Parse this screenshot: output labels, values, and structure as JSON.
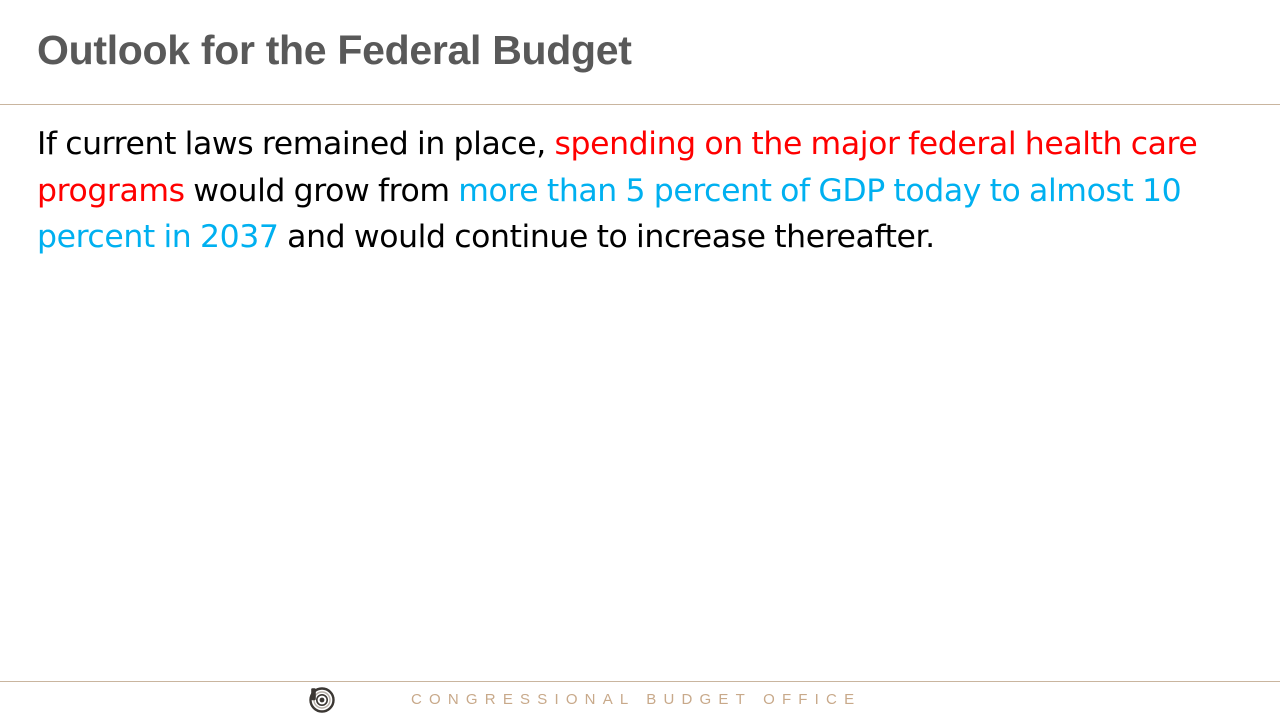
{
  "slide": {
    "title": "Outlook for the Federal Budget",
    "body": {
      "segments": [
        {
          "text": "If current laws remained in place, ",
          "color": "#000000"
        },
        {
          "text": "spending on the major federal health care programs",
          "color": "#ff0000"
        },
        {
          "text": " would grow from ",
          "color": "#000000"
        },
        {
          "text": "more than 5 percent of GDP today to almost 10 percent in 2037",
          "color": "#00b0f0"
        },
        {
          "text": " and would continue to increase thereafter.",
          "color": "#000000"
        }
      ]
    },
    "footer": {
      "text": "CONGRESSIONAL BUDGET OFFICE",
      "logo_icon": "cbo-seal-icon"
    }
  },
  "colors": {
    "title": "#595959",
    "rule": "#c9b59f",
    "footer_text": "#c8a98a",
    "logo_dark": "#3b3733",
    "logo_light": "#b7b0a8"
  }
}
